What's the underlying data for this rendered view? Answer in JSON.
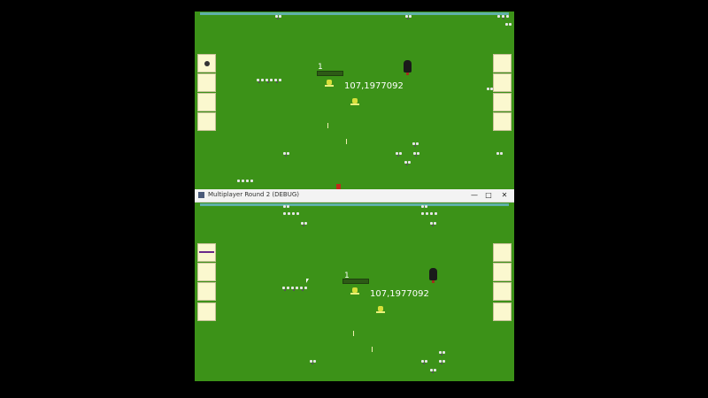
{
  "window": {
    "title": "Multiplayer Round 2 (DEBUG)",
    "minimize_icon": "minimize-icon",
    "maximize_icon": "maximize-icon",
    "close_icon": "close-icon"
  },
  "top_view": {
    "level_label": "1",
    "coords": "107,1977092"
  },
  "bottom_view": {
    "level_label": "1",
    "coords": "107,1977092"
  },
  "colors": {
    "grass": "#3c9218",
    "slot": "#fbf8cf",
    "player": "#d7df3a",
    "top_bar": "#5fb0a8"
  }
}
